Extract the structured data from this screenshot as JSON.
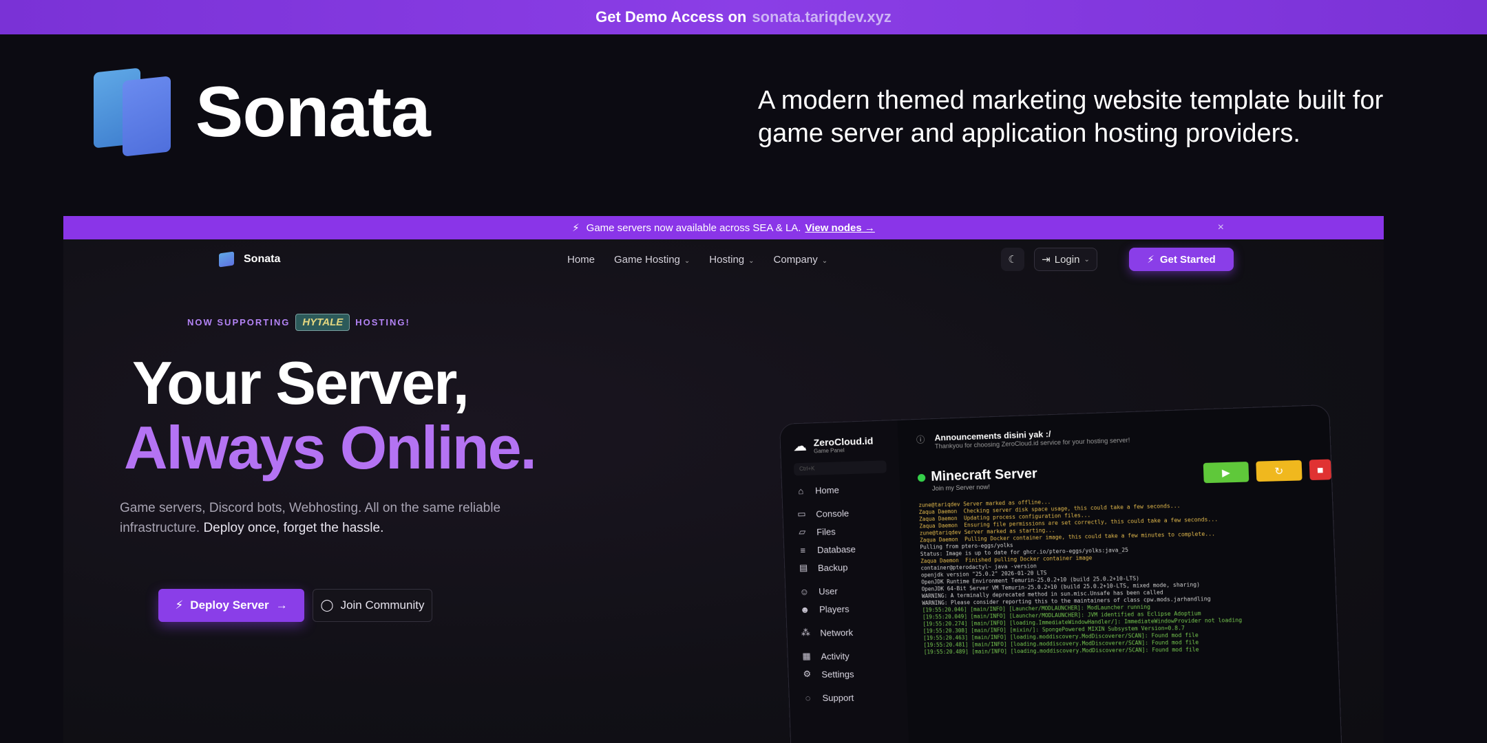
{
  "demo_banner": {
    "prefix": "Get Demo Access on",
    "link": "sonata.tariqdev.xyz"
  },
  "brand": {
    "name": "Sonata"
  },
  "tagline": "A modern themed marketing website template built for game server and application hosting providers.",
  "preview": {
    "announcement": {
      "text": "Game servers now available across SEA & LA.",
      "link": "View nodes →",
      "close": "×"
    },
    "nav": {
      "logo": "Sonata",
      "items": [
        {
          "label": "Home"
        },
        {
          "label": "Game Hosting"
        },
        {
          "label": "Hosting"
        },
        {
          "label": "Company"
        }
      ],
      "login": "Login",
      "get_started": "Get Started"
    },
    "hero": {
      "support_prefix": "NOW SUPPORTING",
      "support_brand": "HYTALE",
      "support_suffix": "HOSTING!",
      "title_line1": "Your Server,",
      "title_line2": "Always Online.",
      "desc_plain": "Game servers, Discord bots, Webhosting. All on the same reliable infrastructure.",
      "desc_emph": "Deploy once, forget the hassle.",
      "deploy_label": "Deploy Server",
      "join_label": "Join Community"
    },
    "panel": {
      "brand": "ZeroCloud.id",
      "brand_sub": "Game Panel",
      "search_placeholder": "Ctrl+K",
      "announcement_title": "Announcements disini yak :/",
      "announcement_sub": "Thankyou for choosing ZeroCloud.id service for your hosting server!",
      "server_name": "Minecraft Server",
      "server_sub": "Join my Server now!",
      "menu": [
        {
          "label": "Home",
          "icon": "home-icon"
        },
        {
          "label": "Console",
          "icon": "terminal-icon"
        },
        {
          "label": "Files",
          "icon": "folder-icon"
        },
        {
          "label": "Database",
          "icon": "database-icon"
        },
        {
          "label": "Backup",
          "icon": "backup-icon"
        },
        {
          "label": "User",
          "icon": "user-icon"
        },
        {
          "label": "Players",
          "icon": "players-icon"
        },
        {
          "label": "Network",
          "icon": "network-icon"
        },
        {
          "label": "Activity",
          "icon": "activity-icon"
        },
        {
          "label": "Settings",
          "icon": "settings-icon"
        },
        {
          "label": "Support",
          "icon": "support-icon"
        }
      ],
      "console_lines": [
        "zune@tariqdev Server marked as offline...",
        "Zaqua Daemon  Checking server disk space usage, this could take a few seconds...",
        "Zaqua Daemon  Updating process configuration files...",
        "Zaqua Daemon  Ensuring file permissions are set correctly, this could take a few seconds...",
        "zune@tariqdev Server marked as starting...",
        "Zaqua Daemon  Pulling Docker container image, this could take a few minutes to complete...",
        "Pulling from ptero-eggs/yolks",
        "Status: Image is up to date for ghcr.io/ptero-eggs/yolks:java_25",
        "Zaqua Daemon  Finished pulling Docker container image",
        "container@pterodactyl~ java -version",
        "openjdk version \"25.0.2\" 2026-01-20 LTS",
        "OpenJDK Runtime Environment Temurin-25.0.2+10 (build 25.0.2+10-LTS)",
        "OpenJDK 64-Bit Server VM Temurin-25.0.2+10 (build 25.0.2+10-LTS, mixed mode, sharing)",
        "WARNING: A terminally deprecated method in sun.misc.Unsafe has been called",
        "WARNING: Please consider reporting this to the maintainers of class cpw.mods.jarhandling",
        "[19:55:20.046] [main/INFO] [Launcher/MODLAUNCHER]: ModLauncher running",
        "[19:55:20.049] [main/INFO] [Launcher/MODLAUNCHER]: JVM identified as Eclipse Adoptium",
        "[19:55:20.274] [main/INFO] [loading.ImmediateWindowHandler/]: ImmediateWindowProvider not loading",
        "[19:55:20.308] [main/INFO] [mixin/]: SpongePowered MIXIN Subsystem Version=0.8.7",
        "[19:55:20.463] [main/INFO] [loading.moddiscovery.ModDiscoverer/SCAN]: Found mod file",
        "[19:55:20.481] [main/INFO] [loading.moddiscovery.ModDiscoverer/SCAN]: Found mod file",
        "[19:55:20.489] [main/INFO] [loading.moddiscovery.ModDiscoverer/SCAN]: Found mod file"
      ]
    }
  }
}
